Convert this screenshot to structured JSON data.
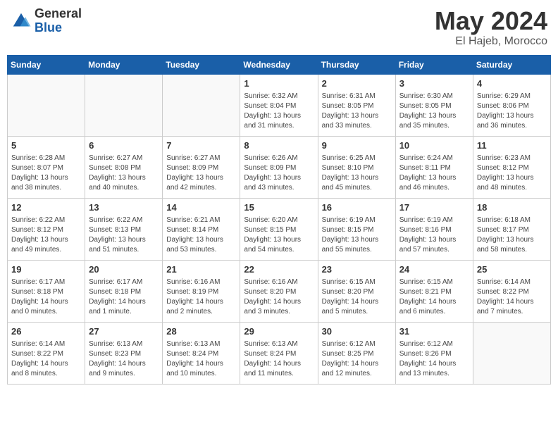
{
  "header": {
    "logo_general": "General",
    "logo_blue": "Blue",
    "month_year": "May 2024",
    "location": "El Hajeb, Morocco"
  },
  "days_of_week": [
    "Sunday",
    "Monday",
    "Tuesday",
    "Wednesday",
    "Thursday",
    "Friday",
    "Saturday"
  ],
  "weeks": [
    [
      {
        "day": "",
        "info": ""
      },
      {
        "day": "",
        "info": ""
      },
      {
        "day": "",
        "info": ""
      },
      {
        "day": "1",
        "info": "Sunrise: 6:32 AM\nSunset: 8:04 PM\nDaylight: 13 hours\nand 31 minutes."
      },
      {
        "day": "2",
        "info": "Sunrise: 6:31 AM\nSunset: 8:05 PM\nDaylight: 13 hours\nand 33 minutes."
      },
      {
        "day": "3",
        "info": "Sunrise: 6:30 AM\nSunset: 8:05 PM\nDaylight: 13 hours\nand 35 minutes."
      },
      {
        "day": "4",
        "info": "Sunrise: 6:29 AM\nSunset: 8:06 PM\nDaylight: 13 hours\nand 36 minutes."
      }
    ],
    [
      {
        "day": "5",
        "info": "Sunrise: 6:28 AM\nSunset: 8:07 PM\nDaylight: 13 hours\nand 38 minutes."
      },
      {
        "day": "6",
        "info": "Sunrise: 6:27 AM\nSunset: 8:08 PM\nDaylight: 13 hours\nand 40 minutes."
      },
      {
        "day": "7",
        "info": "Sunrise: 6:27 AM\nSunset: 8:09 PM\nDaylight: 13 hours\nand 42 minutes."
      },
      {
        "day": "8",
        "info": "Sunrise: 6:26 AM\nSunset: 8:09 PM\nDaylight: 13 hours\nand 43 minutes."
      },
      {
        "day": "9",
        "info": "Sunrise: 6:25 AM\nSunset: 8:10 PM\nDaylight: 13 hours\nand 45 minutes."
      },
      {
        "day": "10",
        "info": "Sunrise: 6:24 AM\nSunset: 8:11 PM\nDaylight: 13 hours\nand 46 minutes."
      },
      {
        "day": "11",
        "info": "Sunrise: 6:23 AM\nSunset: 8:12 PM\nDaylight: 13 hours\nand 48 minutes."
      }
    ],
    [
      {
        "day": "12",
        "info": "Sunrise: 6:22 AM\nSunset: 8:12 PM\nDaylight: 13 hours\nand 49 minutes."
      },
      {
        "day": "13",
        "info": "Sunrise: 6:22 AM\nSunset: 8:13 PM\nDaylight: 13 hours\nand 51 minutes."
      },
      {
        "day": "14",
        "info": "Sunrise: 6:21 AM\nSunset: 8:14 PM\nDaylight: 13 hours\nand 53 minutes."
      },
      {
        "day": "15",
        "info": "Sunrise: 6:20 AM\nSunset: 8:15 PM\nDaylight: 13 hours\nand 54 minutes."
      },
      {
        "day": "16",
        "info": "Sunrise: 6:19 AM\nSunset: 8:15 PM\nDaylight: 13 hours\nand 55 minutes."
      },
      {
        "day": "17",
        "info": "Sunrise: 6:19 AM\nSunset: 8:16 PM\nDaylight: 13 hours\nand 57 minutes."
      },
      {
        "day": "18",
        "info": "Sunrise: 6:18 AM\nSunset: 8:17 PM\nDaylight: 13 hours\nand 58 minutes."
      }
    ],
    [
      {
        "day": "19",
        "info": "Sunrise: 6:17 AM\nSunset: 8:18 PM\nDaylight: 14 hours\nand 0 minutes."
      },
      {
        "day": "20",
        "info": "Sunrise: 6:17 AM\nSunset: 8:18 PM\nDaylight: 14 hours\nand 1 minute."
      },
      {
        "day": "21",
        "info": "Sunrise: 6:16 AM\nSunset: 8:19 PM\nDaylight: 14 hours\nand 2 minutes."
      },
      {
        "day": "22",
        "info": "Sunrise: 6:16 AM\nSunset: 8:20 PM\nDaylight: 14 hours\nand 3 minutes."
      },
      {
        "day": "23",
        "info": "Sunrise: 6:15 AM\nSunset: 8:20 PM\nDaylight: 14 hours\nand 5 minutes."
      },
      {
        "day": "24",
        "info": "Sunrise: 6:15 AM\nSunset: 8:21 PM\nDaylight: 14 hours\nand 6 minutes."
      },
      {
        "day": "25",
        "info": "Sunrise: 6:14 AM\nSunset: 8:22 PM\nDaylight: 14 hours\nand 7 minutes."
      }
    ],
    [
      {
        "day": "26",
        "info": "Sunrise: 6:14 AM\nSunset: 8:22 PM\nDaylight: 14 hours\nand 8 minutes."
      },
      {
        "day": "27",
        "info": "Sunrise: 6:13 AM\nSunset: 8:23 PM\nDaylight: 14 hours\nand 9 minutes."
      },
      {
        "day": "28",
        "info": "Sunrise: 6:13 AM\nSunset: 8:24 PM\nDaylight: 14 hours\nand 10 minutes."
      },
      {
        "day": "29",
        "info": "Sunrise: 6:13 AM\nSunset: 8:24 PM\nDaylight: 14 hours\nand 11 minutes."
      },
      {
        "day": "30",
        "info": "Sunrise: 6:12 AM\nSunset: 8:25 PM\nDaylight: 14 hours\nand 12 minutes."
      },
      {
        "day": "31",
        "info": "Sunrise: 6:12 AM\nSunset: 8:26 PM\nDaylight: 14 hours\nand 13 minutes."
      },
      {
        "day": "",
        "info": ""
      }
    ]
  ]
}
